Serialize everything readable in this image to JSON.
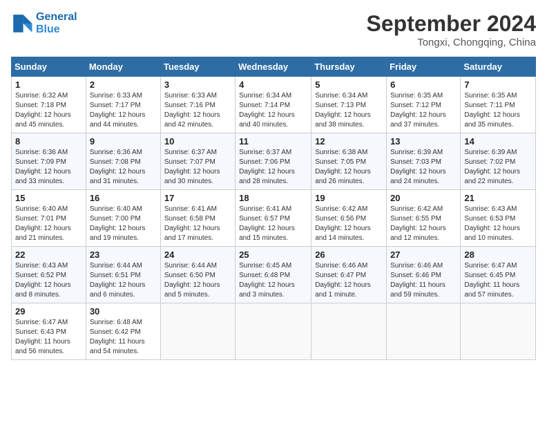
{
  "header": {
    "logo_line1": "General",
    "logo_line2": "Blue",
    "month": "September 2024",
    "location": "Tongxi, Chongqing, China"
  },
  "weekdays": [
    "Sunday",
    "Monday",
    "Tuesday",
    "Wednesday",
    "Thursday",
    "Friday",
    "Saturday"
  ],
  "weeks": [
    [
      {
        "day": "1",
        "sunrise": "6:32 AM",
        "sunset": "7:18 PM",
        "daylight": "12 hours and 45 minutes."
      },
      {
        "day": "2",
        "sunrise": "6:33 AM",
        "sunset": "7:17 PM",
        "daylight": "12 hours and 44 minutes."
      },
      {
        "day": "3",
        "sunrise": "6:33 AM",
        "sunset": "7:16 PM",
        "daylight": "12 hours and 42 minutes."
      },
      {
        "day": "4",
        "sunrise": "6:34 AM",
        "sunset": "7:14 PM",
        "daylight": "12 hours and 40 minutes."
      },
      {
        "day": "5",
        "sunrise": "6:34 AM",
        "sunset": "7:13 PM",
        "daylight": "12 hours and 38 minutes."
      },
      {
        "day": "6",
        "sunrise": "6:35 AM",
        "sunset": "7:12 PM",
        "daylight": "12 hours and 37 minutes."
      },
      {
        "day": "7",
        "sunrise": "6:35 AM",
        "sunset": "7:11 PM",
        "daylight": "12 hours and 35 minutes."
      }
    ],
    [
      {
        "day": "8",
        "sunrise": "6:36 AM",
        "sunset": "7:09 PM",
        "daylight": "12 hours and 33 minutes."
      },
      {
        "day": "9",
        "sunrise": "6:36 AM",
        "sunset": "7:08 PM",
        "daylight": "12 hours and 31 minutes."
      },
      {
        "day": "10",
        "sunrise": "6:37 AM",
        "sunset": "7:07 PM",
        "daylight": "12 hours and 30 minutes."
      },
      {
        "day": "11",
        "sunrise": "6:37 AM",
        "sunset": "7:06 PM",
        "daylight": "12 hours and 28 minutes."
      },
      {
        "day": "12",
        "sunrise": "6:38 AM",
        "sunset": "7:05 PM",
        "daylight": "12 hours and 26 minutes."
      },
      {
        "day": "13",
        "sunrise": "6:39 AM",
        "sunset": "7:03 PM",
        "daylight": "12 hours and 24 minutes."
      },
      {
        "day": "14",
        "sunrise": "6:39 AM",
        "sunset": "7:02 PM",
        "daylight": "12 hours and 22 minutes."
      }
    ],
    [
      {
        "day": "15",
        "sunrise": "6:40 AM",
        "sunset": "7:01 PM",
        "daylight": "12 hours and 21 minutes."
      },
      {
        "day": "16",
        "sunrise": "6:40 AM",
        "sunset": "7:00 PM",
        "daylight": "12 hours and 19 minutes."
      },
      {
        "day": "17",
        "sunrise": "6:41 AM",
        "sunset": "6:58 PM",
        "daylight": "12 hours and 17 minutes."
      },
      {
        "day": "18",
        "sunrise": "6:41 AM",
        "sunset": "6:57 PM",
        "daylight": "12 hours and 15 minutes."
      },
      {
        "day": "19",
        "sunrise": "6:42 AM",
        "sunset": "6:56 PM",
        "daylight": "12 hours and 14 minutes."
      },
      {
        "day": "20",
        "sunrise": "6:42 AM",
        "sunset": "6:55 PM",
        "daylight": "12 hours and 12 minutes."
      },
      {
        "day": "21",
        "sunrise": "6:43 AM",
        "sunset": "6:53 PM",
        "daylight": "12 hours and 10 minutes."
      }
    ],
    [
      {
        "day": "22",
        "sunrise": "6:43 AM",
        "sunset": "6:52 PM",
        "daylight": "12 hours and 8 minutes."
      },
      {
        "day": "23",
        "sunrise": "6:44 AM",
        "sunset": "6:51 PM",
        "daylight": "12 hours and 6 minutes."
      },
      {
        "day": "24",
        "sunrise": "6:44 AM",
        "sunset": "6:50 PM",
        "daylight": "12 hours and 5 minutes."
      },
      {
        "day": "25",
        "sunrise": "6:45 AM",
        "sunset": "6:48 PM",
        "daylight": "12 hours and 3 minutes."
      },
      {
        "day": "26",
        "sunrise": "6:46 AM",
        "sunset": "6:47 PM",
        "daylight": "12 hours and 1 minute."
      },
      {
        "day": "27",
        "sunrise": "6:46 AM",
        "sunset": "6:46 PM",
        "daylight": "11 hours and 59 minutes."
      },
      {
        "day": "28",
        "sunrise": "6:47 AM",
        "sunset": "6:45 PM",
        "daylight": "11 hours and 57 minutes."
      }
    ],
    [
      {
        "day": "29",
        "sunrise": "6:47 AM",
        "sunset": "6:43 PM",
        "daylight": "11 hours and 56 minutes."
      },
      {
        "day": "30",
        "sunrise": "6:48 AM",
        "sunset": "6:42 PM",
        "daylight": "11 hours and 54 minutes."
      },
      null,
      null,
      null,
      null,
      null
    ]
  ]
}
